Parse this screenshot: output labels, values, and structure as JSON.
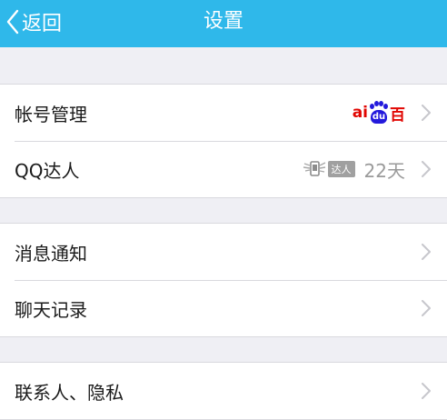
{
  "nav": {
    "back_label": "返回",
    "title": "设置",
    "background": "#2fb8ea"
  },
  "groups": [
    {
      "rows": [
        {
          "label": "帐号管理",
          "right_icon": "baidu-logo-icon",
          "baidu_left": "ai",
          "baidu_paw": "du",
          "baidu_right": "百"
        },
        {
          "label": "QQ达人",
          "right_icon": "qq-talent-badge-icon",
          "badge_text": "达人",
          "right_text": "22天"
        }
      ]
    },
    {
      "rows": [
        {
          "label": "消息通知"
        },
        {
          "label": "聊天记录"
        }
      ]
    },
    {
      "rows": [
        {
          "label": "联系人、隐私"
        }
      ]
    }
  ],
  "colors": {
    "chevron": "#c7c7cc",
    "separator": "#d9d9de",
    "background": "#efeff4"
  }
}
